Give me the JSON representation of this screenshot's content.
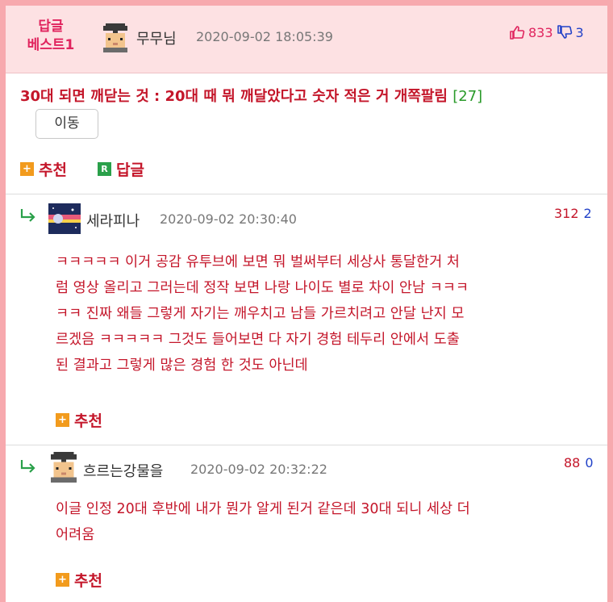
{
  "best": {
    "badge_line1": "답글",
    "badge_line2": "베스트1",
    "username": "무무님",
    "date": "2020-09-02 18:05:39",
    "upvotes": "833",
    "downvotes": "3",
    "title": "30대 되면 깨닫는 것 : 20대 때 뭐 깨달았다고 숫자 적은 거 개쪽팔림",
    "reply_count": "[27]",
    "move_label": "이동",
    "recommend_label": "추천",
    "reply_label": "답글"
  },
  "comments": [
    {
      "username": "세라피나",
      "date": "2020-09-02 20:30:40",
      "upvotes": "312",
      "downvotes": "2",
      "lines": [
        "ㅋㅋㅋㅋㅋ 이거 공감 유투브에 보면 뭐 벌써부터 세상사 통달한거 처",
        "럼 영상 올리고 그러는데 정작 보면 나랑 나이도 별로 차이 안남 ㅋㅋㅋ",
        "ㅋㅋ 진짜 왜들 그렇게 자기는 깨우치고 남들 가르치려고 안달 난지 모",
        "르겠음 ㅋㅋㅋㅋㅋ 그것도 들어보면 다 자기 경험 테두리 안에서 도출",
        "된 결과고 그렇게 많은 경험 한 것도 아닌데"
      ],
      "recommend_label": "추천"
    },
    {
      "username": "흐르는강물을",
      "date": "2020-09-02 20:32:22",
      "upvotes": "88",
      "downvotes": "0",
      "lines": [
        "이글 인정 20대 후반에 내가 뭔가 알게 된거 같은데 30대 되니 세상 더",
        "어려움"
      ],
      "recommend_label": "추천"
    }
  ],
  "icons": {
    "reply_arrow": "reply-arrow-icon",
    "thumbs_up": "thumbs-up-icon",
    "thumbs_down": "thumbs-down-icon",
    "plus": "plus-icon",
    "reply_r": "reply-r-icon"
  },
  "colors": {
    "accent_red": "#c4162a",
    "badge_pink": "#e0245e",
    "header_bg": "#fde1e3",
    "outer_border": "#f7a9ae",
    "green": "#2aa04a",
    "orange": "#f29b1d",
    "blue": "#2242c8"
  }
}
